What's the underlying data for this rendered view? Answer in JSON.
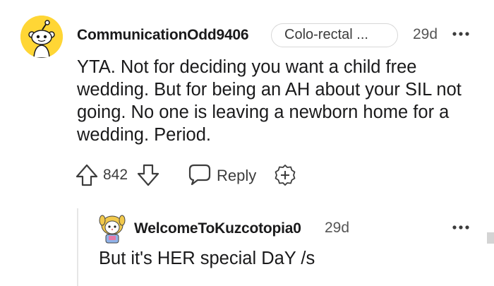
{
  "comment": {
    "avatar_icon": "snoo-avatar-icon",
    "avatar_bg": "#ffd635",
    "username": "CommunicationOdd9406",
    "flair": "Colo-rectal ...",
    "timestamp": "29d",
    "more_icon": "more-options-icon",
    "body": "YTA. Not for deciding you want a child free wedding. But for being an AH about your SIL not going. No one is leaving a newborn home for a wedding. Period.",
    "vote_count": "842",
    "reply_label": "Reply",
    "upvote_icon": "upvote-arrow-icon",
    "downvote_icon": "downvote-arrow-icon",
    "reply_icon": "comment-bubble-icon",
    "award_icon": "add-award-icon"
  },
  "reply": {
    "avatar_icon": "character-avatar-icon",
    "username": "WelcomeToKuzcotopia0",
    "timestamp": "29d",
    "more_icon": "more-options-icon",
    "body": "But it's HER special DaY /s"
  }
}
